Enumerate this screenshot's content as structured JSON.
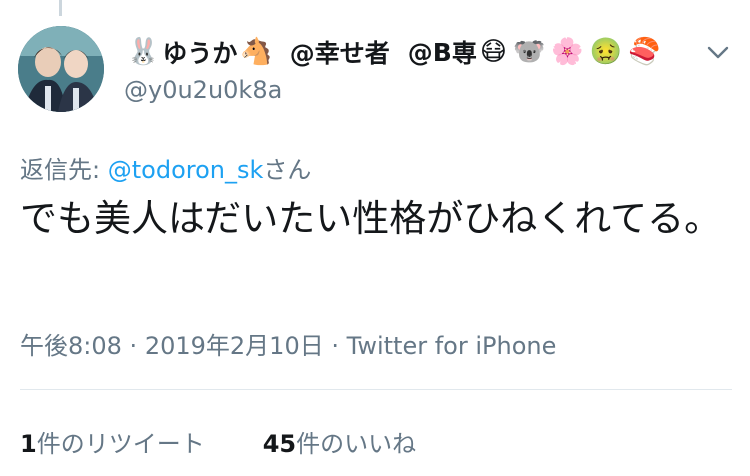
{
  "user": {
    "name_prefix_icon": "rabbit-emoji",
    "name_part1": "ゆうか",
    "name_icon2": "horse-face-emoji",
    "name_part2": "@幸せ者",
    "name_part3": "@B",
    "name_part3_cut": "専",
    "name_trailing_icons": [
      "mask-face-emoji",
      "koala-emoji",
      "cherry-blossom-emoji",
      "nauseated-face-emoji",
      "sushi-emoji"
    ],
    "handle": "@y0u2u0k8a",
    "menu_icon": "chevron-down-icon"
  },
  "reply": {
    "prefix": "返信先:",
    "mention": "@todoron_sk",
    "suffix": "さん"
  },
  "tweet": {
    "text": "でも美人はだいたい性格がひねくれてる。"
  },
  "meta": {
    "time": "午後8:08",
    "separator": "·",
    "date": "2019年2月10日",
    "source": "Twitter for iPhone"
  },
  "stats": {
    "retweets_count": "1",
    "retweets_label": "件のリツイート",
    "likes_count": "45",
    "likes_label": "件のいいね"
  },
  "colors": {
    "text": "#14171a",
    "secondary": "#657786",
    "link": "#1da1f2",
    "divider": "#e1e8ed"
  }
}
